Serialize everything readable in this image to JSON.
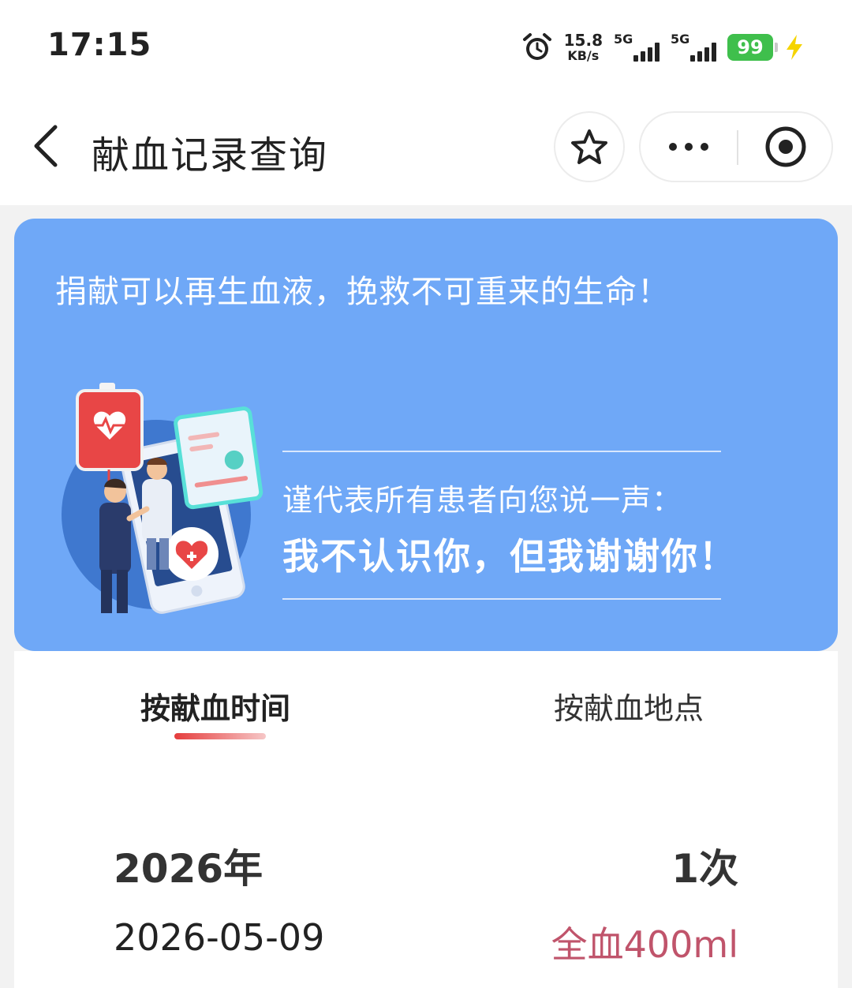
{
  "status_bar": {
    "time": "17:15",
    "net_speed_value": "15.8",
    "net_speed_unit": "KB/s",
    "sim1_label": "5G",
    "sim2_label": "5G",
    "battery": "99"
  },
  "nav": {
    "title": "献血记录查询"
  },
  "banner": {
    "slogan": "捐献可以再生血液，挽救不可重来的生命！",
    "thanks_sub": "谨代表所有患者向您说一声：",
    "thanks_main": "我不认识你，但我谢谢你！"
  },
  "tabs": [
    {
      "label": "按献血时间",
      "active": true
    },
    {
      "label": "按献血地点",
      "active": false
    }
  ],
  "records": {
    "year": "2026年",
    "count": "1次",
    "items": [
      {
        "date": "2026-05-09",
        "amount": "全血400ml"
      }
    ]
  },
  "colors": {
    "banner_bg": "#6fa8f7",
    "accent_red": "#e53d3d",
    "amount_text": "#c0546b",
    "battery_green": "#3fbf4c"
  },
  "icons": [
    "alarm-icon",
    "signal-icon",
    "battery-icon",
    "charging-icon",
    "back-arrow-icon",
    "star-icon",
    "more-dots-icon",
    "close-target-icon"
  ]
}
